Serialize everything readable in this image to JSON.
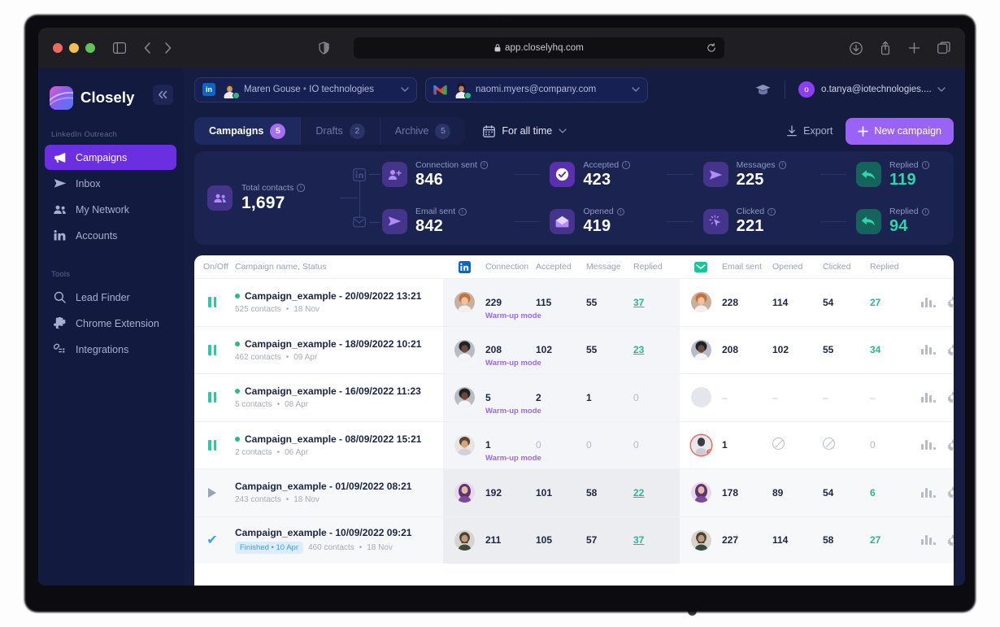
{
  "browser": {
    "url": "app.closelyhq.com",
    "lock_icon": "lock-icon",
    "reload_icon": "reload-icon",
    "back_icon": "back-arrow-icon",
    "forward_icon": "forward-arrow-icon",
    "sidebar_icon": "sidebar-toggle-icon",
    "shield_icon": "shield-icon",
    "download_icon": "download-icon",
    "share_icon": "share-icon",
    "newtab_icon": "plus-icon",
    "tabs_icon": "tabs-overview-icon"
  },
  "sidebar": {
    "brand": "Closely",
    "collapse_icon": "chevron-double-left-icon",
    "section_1": "LinkedIn Outreach",
    "section_2": "Tools",
    "items": [
      {
        "label": "Campaigns",
        "icon": "megaphone-icon",
        "active": true
      },
      {
        "label": "Inbox",
        "icon": "send-icon",
        "active": false
      },
      {
        "label": "My Network",
        "icon": "people-icon",
        "active": false
      },
      {
        "label": "Accounts",
        "icon": "linkedin-icon",
        "active": false
      }
    ],
    "tools": [
      {
        "label": "Lead Finder",
        "icon": "search-icon"
      },
      {
        "label": "Chrome Extension",
        "icon": "puzzle-icon"
      },
      {
        "label": "Integrations",
        "icon": "plug-icon"
      }
    ]
  },
  "header": {
    "linkedin_account": {
      "name": "Maren Gouse",
      "separator": "•",
      "company": "IO technologies",
      "badge": "in"
    },
    "email_account": {
      "address": "naomi.myers@company.com",
      "badge": "gmail-icon"
    },
    "graduation_icon": "graduation-cap-icon",
    "user": {
      "initial": "o",
      "email": "o.tanya@iotechnologies...."
    }
  },
  "toolbar": {
    "tabs": [
      {
        "label": "Campaigns",
        "count": "5",
        "active": true
      },
      {
        "label": "Drafts",
        "count": "2",
        "active": false
      },
      {
        "label": "Archive",
        "count": "5",
        "active": false
      }
    ],
    "date_filter": "For all time",
    "calendar_icon": "calendar-icon",
    "export_label": "Export",
    "export_icon": "download-icon",
    "new_campaign_label": "New campaign",
    "new_campaign_icon": "plus-icon"
  },
  "stats": {
    "total": {
      "label": "Total contacts",
      "value": "1,697",
      "icon": "people-icon"
    },
    "linkedin_branch_icon": "linkedin-icon",
    "email_branch_icon": "envelope-icon",
    "row_linkedin": [
      {
        "label": "Connection sent",
        "value": "846",
        "icon": "person-add-icon",
        "color": "#ffffff"
      },
      {
        "label": "Accepted",
        "value": "423",
        "icon": "check-circle-icon",
        "color": "#ffffff"
      },
      {
        "label": "Messages",
        "value": "225",
        "icon": "send-icon",
        "color": "#ffffff"
      },
      {
        "label": "Replied",
        "value": "119",
        "icon": "reply-icon",
        "color": "#2fd6a8"
      }
    ],
    "row_email": [
      {
        "label": "Email sent",
        "value": "842",
        "icon": "send-icon",
        "color": "#ffffff"
      },
      {
        "label": "Opened",
        "value": "419",
        "icon": "envelope-open-icon",
        "color": "#ffffff"
      },
      {
        "label": "Clicked",
        "value": "221",
        "icon": "cursor-click-icon",
        "color": "#ffffff"
      },
      {
        "label": "Replied",
        "value": "94",
        "icon": "reply-icon",
        "color": "#2fd6a8"
      }
    ]
  },
  "table": {
    "headers": {
      "onoff": "On/Off",
      "name": "Campaign name, Status",
      "linkedin_icon": "linkedin-icon",
      "li_connection": "Connection",
      "li_accepted": "Accepted",
      "li_message": "Message",
      "li_replied": "Replied",
      "email_icon": "envelope-icon",
      "em_sent": "Email sent",
      "em_opened": "Opened",
      "em_clicked": "Clicked",
      "em_replied": "Replied"
    },
    "rows": [
      {
        "state_icon": "pause-icon",
        "state": "paused",
        "name": "Campaign_example - 20/09/2022 13:21",
        "sub_contacts": "525 contacts",
        "sub_sep": "•",
        "sub_date": "18 Nov",
        "has_dot": true,
        "badge": "",
        "warmup": "Warm-up mode",
        "li": {
          "connection": "229",
          "accepted": "115",
          "message": "55",
          "replied": "37"
        },
        "em": {
          "sent": "228",
          "opened": "114",
          "clicked": "54",
          "replied": "27"
        },
        "li_avatar": "avatar-redhead",
        "em_avatar": "avatar-redhead",
        "shaded": false
      },
      {
        "state_icon": "pause-icon",
        "state": "paused",
        "name": "Campaign_example - 18/09/2022 10:21",
        "sub_contacts": "462 contacts",
        "sub_sep": "•",
        "sub_date": "09 Apr",
        "has_dot": true,
        "badge": "",
        "warmup": "Warm-up mode",
        "li": {
          "connection": "208",
          "accepted": "102",
          "message": "55",
          "replied": "23"
        },
        "em": {
          "sent": "208",
          "opened": "102",
          "clicked": "55",
          "replied": "34"
        },
        "li_avatar": "avatar-dark",
        "em_avatar": "avatar-dark",
        "shaded": false
      },
      {
        "state_icon": "pause-icon",
        "state": "paused",
        "name": "Campaign_example - 16/09/2022 11:23",
        "sub_contacts": "5 contacts",
        "sub_sep": "•",
        "sub_date": "08 Apr",
        "has_dot": true,
        "badge": "",
        "warmup": "Warm-up mode",
        "li": {
          "connection": "5",
          "accepted": "2",
          "message": "1",
          "replied": "0"
        },
        "em": {
          "sent": "–",
          "opened": "–",
          "clicked": "–",
          "replied": "–"
        },
        "li_avatar": "avatar-dark",
        "em_avatar": "avatar-empty",
        "shaded": false
      },
      {
        "state_icon": "pause-icon",
        "state": "paused",
        "name": "Campaign_example - 08/09/2022 15:21",
        "sub_contacts": "2 contacts",
        "sub_sep": "•",
        "sub_date": "06 Apr",
        "has_dot": true,
        "badge": "",
        "warmup": "Warm-up mode",
        "li": {
          "connection": "1",
          "accepted": "0",
          "message": "0",
          "replied": "0"
        },
        "em": {
          "sent": "1",
          "opened": "blocked-icon",
          "clicked": "blocked-icon",
          "replied": "0"
        },
        "li_avatar": "avatar-light",
        "em_avatar": "avatar-error",
        "shaded": false
      },
      {
        "state_icon": "play-icon",
        "state": "stopped",
        "name": "Campaign_example - 01/09/2022 08:21",
        "sub_contacts": "243 contacts",
        "sub_sep": "•",
        "sub_date": "18 Nov",
        "has_dot": false,
        "badge": "",
        "warmup": "",
        "li": {
          "connection": "192",
          "accepted": "101",
          "message": "58",
          "replied": "22"
        },
        "em": {
          "sent": "178",
          "opened": "89",
          "clicked": "54",
          "replied": "6"
        },
        "li_avatar": "avatar-purple",
        "em_avatar": "avatar-purple",
        "shaded": true
      },
      {
        "state_icon": "check-icon",
        "state": "finished",
        "name": "Campaign_example - 10/09/2022 09:21",
        "sub_contacts": "460 contacts",
        "sub_sep": "•",
        "sub_date": "18 Nov",
        "has_dot": false,
        "badge": "Finished • 10 Apr",
        "warmup": "",
        "li": {
          "connection": "211",
          "accepted": "105",
          "message": "57",
          "replied": "37"
        },
        "em": {
          "sent": "227",
          "opened": "114",
          "clicked": "58",
          "replied": "27"
        },
        "li_avatar": "avatar-beard",
        "em_avatar": "avatar-beard",
        "shaded": true
      }
    ],
    "row_actions": {
      "chart_icon": "bar-chart-icon",
      "settings_icon": "gear-icon"
    }
  },
  "colors": {
    "accent_purple": "#9b63f5",
    "teal": "#2bc9a4",
    "sidebar_bg": "#131a40",
    "panel_bg": "#1b2350"
  }
}
